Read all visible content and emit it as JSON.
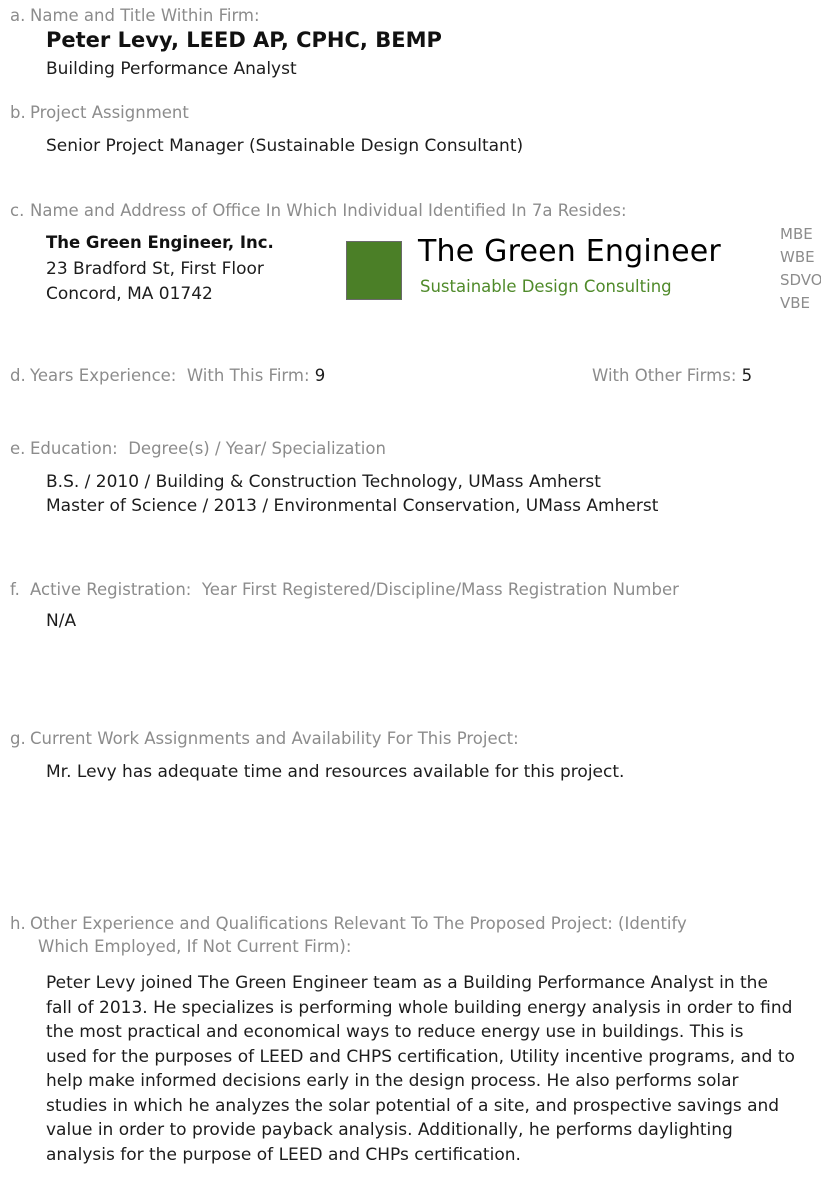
{
  "section_a": {
    "letter": "a.",
    "label": "Name and Title Within Firm:",
    "name": "Peter Levy, LEED AP, CPHC, BEMP",
    "title": "Building Performance Analyst"
  },
  "section_b": {
    "letter": "b.",
    "label": "Project Assignment",
    "value": "Senior Project Manager (Sustainable Design Consultant)"
  },
  "section_c": {
    "letter": "c.",
    "label": "Name and Address of Office In Which Individual Identified In 7a Resides:",
    "firm": "The Green Engineer, Inc.",
    "address_line1": "23 Bradford St, First Floor",
    "address_line2": "Concord, MA  01742",
    "logo_title": "The Green Engineer",
    "logo_subtitle": "Sustainable Design Consulting",
    "logo_color": "#4b7f27",
    "certifications": [
      "MBE",
      "WBE",
      "SDVO",
      "VBE"
    ]
  },
  "section_d": {
    "letter": "d.",
    "label": "Years Experience:",
    "this_firm_label": "With This Firm:",
    "this_firm_value": "9",
    "other_firms_label": "With Other Firms:",
    "other_firms_value": "5"
  },
  "section_e": {
    "letter": "e.",
    "label": "Education:",
    "sublabel": "Degree(s) / Year/ Specialization",
    "lines": [
      "B.S. / 2010 / Building & Construction Technology, UMass Amherst",
      "Master of Science / 2013 / Environmental Conservation, UMass Amherst"
    ]
  },
  "section_f": {
    "letter": "f.",
    "label": "Active Registration:",
    "sublabel": "Year First Registered/Discipline/Mass Registration Number",
    "value": "N/A"
  },
  "section_g": {
    "letter": "g.",
    "label": "Current Work Assignments and Availability For This Project:",
    "value": "Mr. Levy has adequate time and resources available for this project."
  },
  "section_h": {
    "letter": "h.",
    "label_line1": "Other Experience and Qualifications Relevant To The Proposed Project: (Identify",
    "label_line2": "Which Employed, If Not Current Firm):",
    "paragraph": [
      "Peter Levy joined The Green Engineer team as a Building Performance Analyst in the",
      "fall of 2013. He specializes is performing whole building energy analysis in order to find",
      "the most practical and economical ways to reduce energy use in buildings. This is",
      "used for the purposes of LEED and CHPS certification, Utility incentive programs, and to",
      "help make informed decisions early in the design process. He also performs solar",
      "studies in which he analyzes the solar potential of a site, and prospective savings and",
      "value in order to provide payback analysis. Additionally, he performs daylighting",
      "analysis for the purpose of LEED and CHPs certification."
    ]
  }
}
